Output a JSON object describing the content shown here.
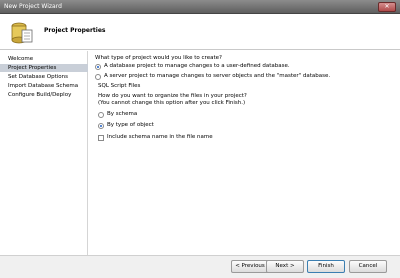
{
  "window": {
    "title": "New Project Wizard",
    "close": "✕"
  },
  "banner": {
    "heading": "Project Properties"
  },
  "sidebar": {
    "items": [
      {
        "label": "Welcome"
      },
      {
        "label": "Project Properties"
      },
      {
        "label": "Set Database Options"
      },
      {
        "label": "Import Database Schema"
      },
      {
        "label": "Configure Build/Deploy"
      }
    ]
  },
  "content": {
    "question": "What type of project would you like to create?",
    "option_db": "A database project to manage changes to a user-defined database.",
    "option_server": "A server project to manage changes to server objects and the \"master\" database.",
    "sql_section": "SQL Script Files",
    "organize_q1": "How do you want to organize the files in your project?",
    "organize_q2": "(You cannot change this option after you click Finish.)",
    "by_schema": "By schema",
    "by_type": "By type of object",
    "include_schema": "Include schema name in the file name"
  },
  "buttons": {
    "previous": "< Previous",
    "next": "Next >",
    "finish": "Finish",
    "cancel": "Cancel"
  }
}
